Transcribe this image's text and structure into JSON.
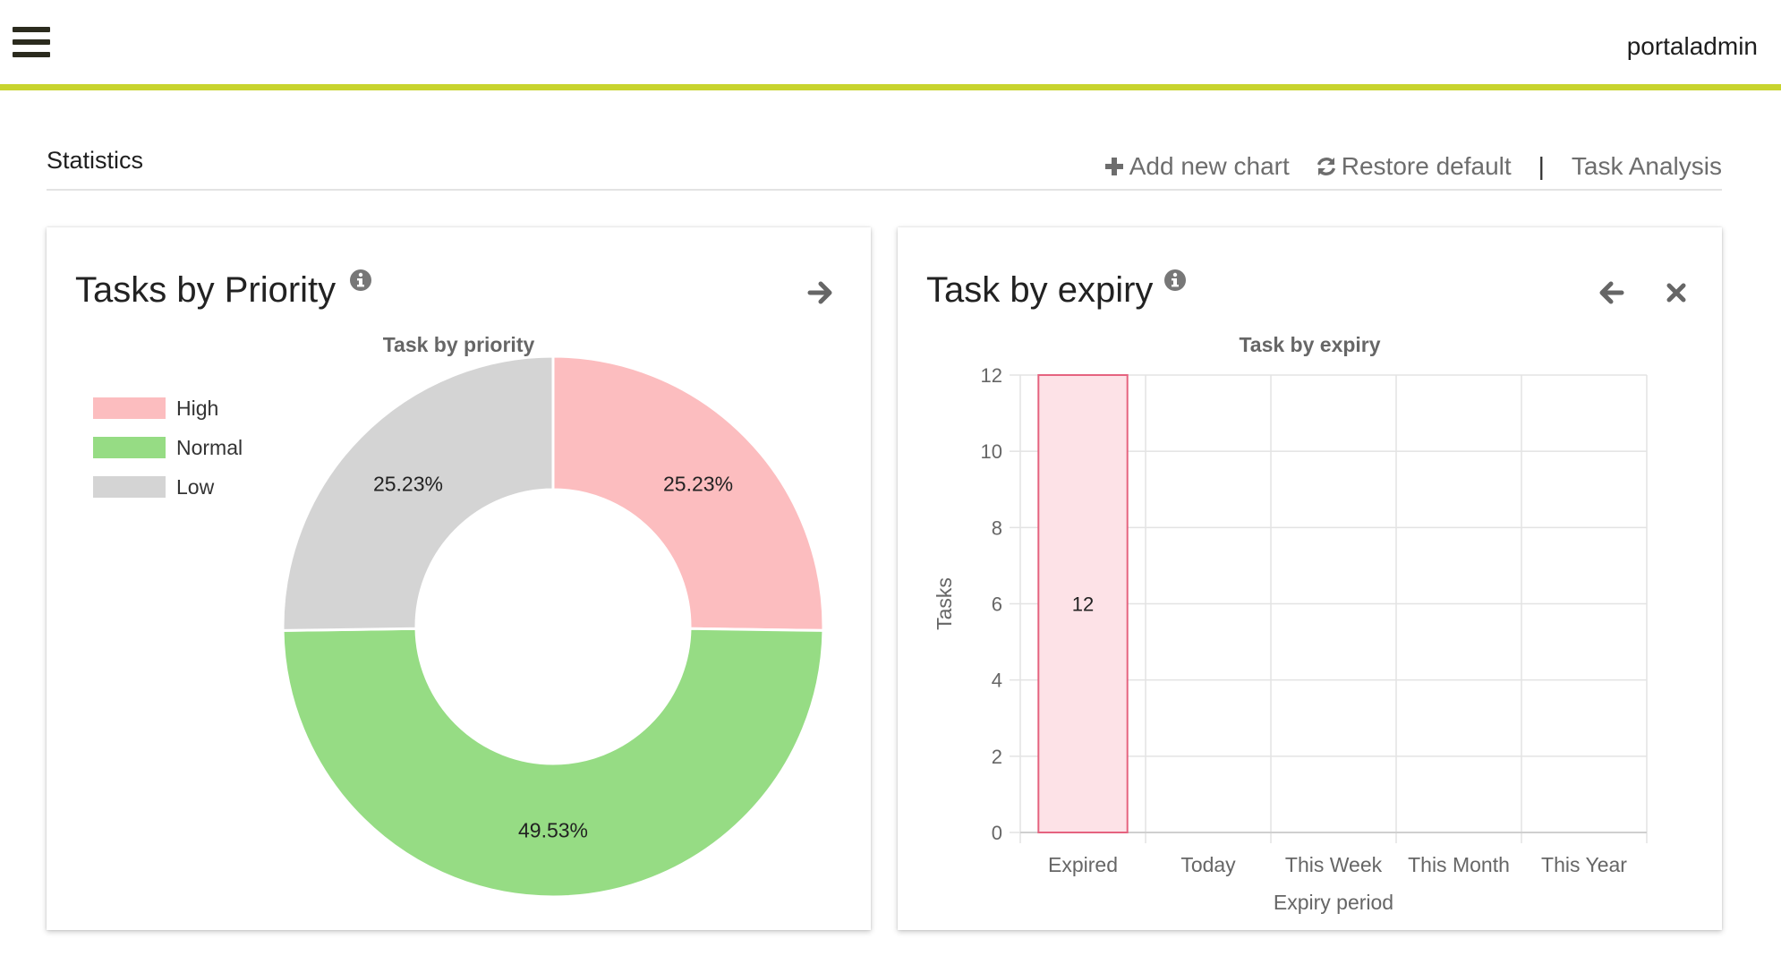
{
  "app": {
    "user": "portaladmin",
    "accent_color": "#c8d42e"
  },
  "header": {
    "title": "Statistics",
    "add_chart_label": "Add new chart",
    "restore_label": "Restore default",
    "separator": "|",
    "task_analysis_label": "Task Analysis"
  },
  "cards": {
    "priority": {
      "title": "Tasks by Priority",
      "chart_title": "Task by priority",
      "icons": [
        "info-icon",
        "arrow-right-icon"
      ]
    },
    "expiry": {
      "title": "Task by expiry",
      "chart_title": "Task by expiry",
      "icons": [
        "info-icon",
        "arrow-left-icon",
        "close-icon"
      ]
    }
  },
  "chart_data": [
    {
      "type": "pie",
      "variant": "doughnut",
      "title": "Task by priority",
      "legend_position": "top-left",
      "slices": [
        {
          "label": "High",
          "value": 25.23,
          "display": "25.23%",
          "color": "#fcbdbf"
        },
        {
          "label": "Normal",
          "value": 49.53,
          "display": "49.53%",
          "color": "#96dc84"
        },
        {
          "label": "Low",
          "value": 25.23,
          "display": "25.23%",
          "color": "#d4d4d4"
        }
      ]
    },
    {
      "type": "bar",
      "title": "Task by expiry",
      "xlabel": "Expiry period",
      "ylabel": "Tasks",
      "categories": [
        "Expired",
        "Today",
        "This Week",
        "This Month",
        "This Year"
      ],
      "values": [
        12,
        0,
        0,
        0,
        0
      ],
      "data_labels": [
        "12",
        "",
        "",
        "",
        ""
      ],
      "ylim": [
        0,
        12
      ],
      "yticks": [
        0,
        2,
        4,
        6,
        8,
        10,
        12
      ],
      "grid": true,
      "bar_fill": "#fde2e7",
      "bar_stroke": "#e5637f"
    }
  ]
}
